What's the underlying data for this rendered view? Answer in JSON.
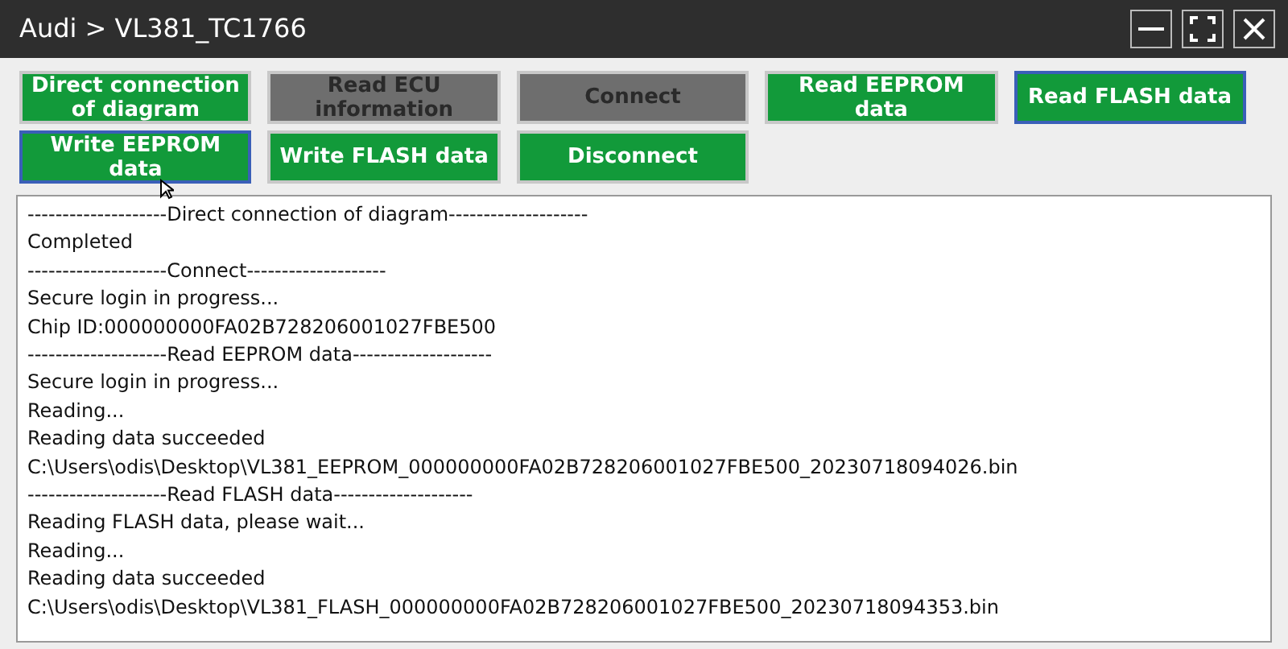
{
  "window": {
    "title": "Audi > VL381_TC1766"
  },
  "buttons": [
    {
      "label": "Direct connection of diagram",
      "disabled": false,
      "focused": false
    },
    {
      "label": "Read ECU information",
      "disabled": true,
      "focused": false
    },
    {
      "label": "Connect",
      "disabled": true,
      "focused": false
    },
    {
      "label": "Read EEPROM data",
      "disabled": false,
      "focused": false
    },
    {
      "label": "Read FLASH data",
      "disabled": false,
      "focused": true
    },
    {
      "label": "Write EEPROM data",
      "disabled": false,
      "focused": true
    },
    {
      "label": "Write FLASH data",
      "disabled": false,
      "focused": false
    },
    {
      "label": "Disconnect",
      "disabled": false,
      "focused": false
    }
  ],
  "log": [
    "--------------------Direct connection of diagram--------------------",
    "Completed",
    "--------------------Connect--------------------",
    "Secure login in progress...",
    "Chip ID:000000000FA02B728206001027FBE500",
    "--------------------Read EEPROM data--------------------",
    "Secure login in progress...",
    "Reading...",
    "Reading data succeeded",
    "C:\\Users\\odis\\Desktop\\VL381_EEPROM_000000000FA02B728206001027FBE500_20230718094026.bin",
    "--------------------Read FLASH data--------------------",
    "Reading FLASH data, please wait...",
    "Reading...",
    "Reading data succeeded",
    "C:\\Users\\odis\\Desktop\\VL381_FLASH_000000000FA02B728206001027FBE500_20230718094353.bin"
  ]
}
